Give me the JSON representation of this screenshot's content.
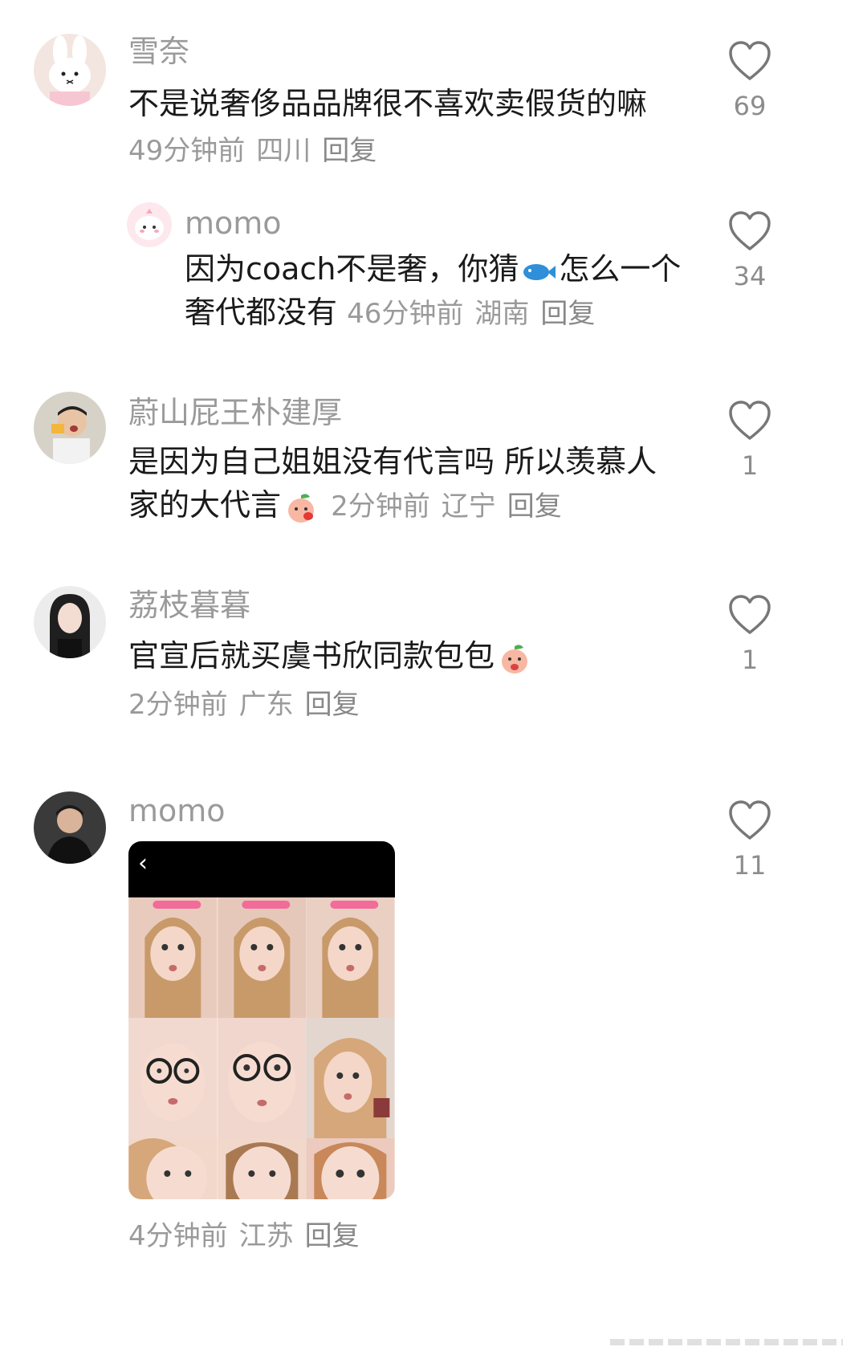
{
  "comments": [
    {
      "username": "雪奈",
      "text": "不是说奢侈品品牌很不喜欢卖假货的嘛",
      "time": "49分钟前",
      "location": "四川",
      "reply": "回复",
      "likes": "69"
    },
    {
      "username": "momo",
      "text_line1": "因为coach不是奢，你猜",
      "text_line1_after": "怎么一个",
      "text_line2": "奢代都没有",
      "time": "46分钟前",
      "location": "湖南",
      "reply": "回复",
      "likes": "34"
    },
    {
      "username": "蔚山屁王朴建厚",
      "text_line1": "是因为自己姐姐没有代言吗 所以羡慕人",
      "text_line2": "家的大代言",
      "time": "2分钟前",
      "location": "辽宁",
      "reply": "回复",
      "likes": "1"
    },
    {
      "username": "荔枝暮暮",
      "text": "官宣后就买虞书欣同款包包",
      "time": "2分钟前",
      "location": "广东",
      "reply": "回复",
      "likes": "1"
    },
    {
      "username": "momo",
      "back_icon": "‹",
      "time": "4分钟前",
      "location": "江苏",
      "reply": "回复",
      "likes": "11"
    }
  ],
  "icons": {
    "like": "heart-outline-icon",
    "fish_emoji": "fish-emoji",
    "peach_emoji": "peach-emoji"
  },
  "colors": {
    "username": "#9a9a9a",
    "text": "#1a1a1a",
    "meta": "#9a9a9a"
  }
}
